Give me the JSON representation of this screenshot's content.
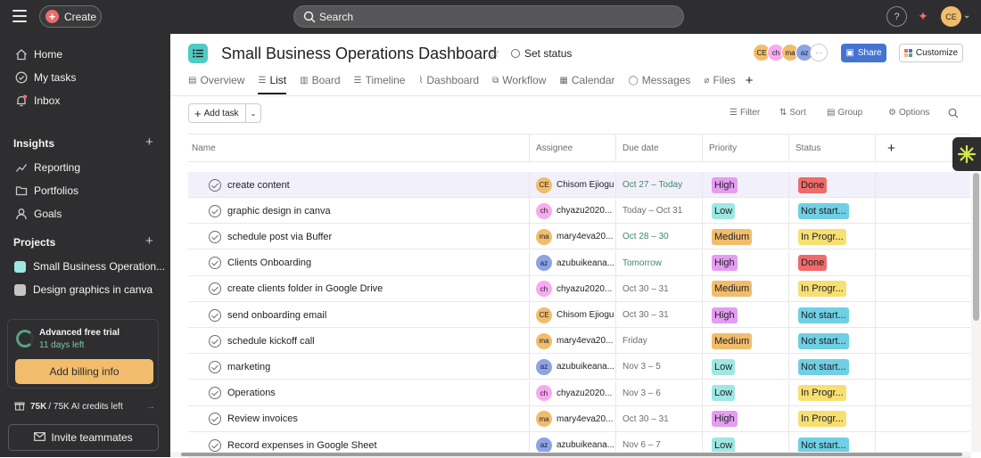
{
  "topbar": {
    "create_label": "Create",
    "search_placeholder": "Search",
    "help_label": "?",
    "user_initials": "CE"
  },
  "sidebar": {
    "nav": [
      {
        "label": "Home",
        "icon": "home-icon"
      },
      {
        "label": "My tasks",
        "icon": "check-circle-icon"
      },
      {
        "label": "Inbox",
        "icon": "bell-icon"
      }
    ],
    "insights_title": "Insights",
    "insights": [
      {
        "label": "Reporting",
        "icon": "chart-icon"
      },
      {
        "label": "Portfolios",
        "icon": "folder-icon"
      },
      {
        "label": "Goals",
        "icon": "person-icon"
      }
    ],
    "projects_title": "Projects",
    "projects": [
      {
        "label": "Small Business Operation...",
        "color": "#9ee7e3"
      },
      {
        "label": "Design graphics in canva",
        "color": "#c7c4c4"
      }
    ],
    "trial": {
      "title": "Advanced free trial",
      "days_left": "11 days left",
      "billing_label": "Add billing info"
    },
    "credits": {
      "strong": "75K",
      "rest": "/ 75K AI credits left"
    },
    "invite_label": "Invite teammates"
  },
  "project": {
    "title": "Small Business Operations Dashboard",
    "set_status": "Set status",
    "members": [
      {
        "initials": "CE",
        "color": "#f1bd6c"
      },
      {
        "initials": "ch",
        "color": "#f9aaef"
      },
      {
        "initials": "ma",
        "color": "#f1bd6c"
      },
      {
        "initials": "az",
        "color": "#8da3e6"
      }
    ],
    "more_members": "···",
    "share_label": "Share",
    "customize_label": "Customize"
  },
  "tabs": [
    {
      "label": "Overview",
      "icon": "overview-icon",
      "glyph": "▤"
    },
    {
      "label": "List",
      "icon": "list-icon",
      "glyph": "☰"
    },
    {
      "label": "Board",
      "icon": "board-icon",
      "glyph": "▥"
    },
    {
      "label": "Timeline",
      "icon": "timeline-icon",
      "glyph": "☰"
    },
    {
      "label": "Dashboard",
      "icon": "dashboard-icon",
      "glyph": "⌇"
    },
    {
      "label": "Workflow",
      "icon": "workflow-icon",
      "glyph": "⧉"
    },
    {
      "label": "Calendar",
      "icon": "calendar-icon",
      "glyph": "▦"
    },
    {
      "label": "Messages",
      "icon": "message-icon",
      "glyph": "◯"
    },
    {
      "label": "Files",
      "icon": "attachment-icon",
      "glyph": "⌀"
    }
  ],
  "toolbar": {
    "add_task_label": "Add task",
    "filter_label": "Filter",
    "sort_label": "Sort",
    "group_label": "Group",
    "options_label": "Options"
  },
  "columns": {
    "name": "Name",
    "assignee": "Assignee",
    "due_date": "Due date",
    "priority": "Priority",
    "status": "Status"
  },
  "colors": {
    "high": "#e49df0",
    "low": "#9ee7e3",
    "medium": "#f1bd6c",
    "done": "#f06a6a",
    "not_started": "#6fd0e5",
    "in_progress": "#f8df72"
  },
  "tasks": [
    {
      "name": "create content",
      "assignee": "Chisom Ejiogu",
      "initials": "CE",
      "avatar_color": "#f1bd6c",
      "due": "Oct 27 – Today",
      "due_green": true,
      "priority": "High",
      "priority_key": "high",
      "status": "Done",
      "status_key": "done"
    },
    {
      "name": "graphic design in canva",
      "assignee": "chyazu2020...",
      "initials": "ch",
      "avatar_color": "#f9aaef",
      "due": "Today – Oct 31",
      "due_green": false,
      "priority": "Low",
      "priority_key": "low",
      "status": "Not start...",
      "status_key": "not_started"
    },
    {
      "name": "schedule post via Buffer",
      "assignee": "mary4eva20...",
      "initials": "ma",
      "avatar_color": "#f1bd6c",
      "due": "Oct 28 – 30",
      "due_green": true,
      "priority": "Medium",
      "priority_key": "medium",
      "status": "In Progr...",
      "status_key": "in_progress"
    },
    {
      "name": "Clients Onboarding",
      "assignee": "azubuikeana...",
      "initials": "az",
      "avatar_color": "#8da3e6",
      "due": "Tomorrow",
      "due_green": true,
      "priority": "High",
      "priority_key": "high",
      "status": "Done",
      "status_key": "done"
    },
    {
      "name": "create clients folder in Google Drive",
      "assignee": "chyazu2020...",
      "initials": "ch",
      "avatar_color": "#f9aaef",
      "due": "Oct 30 – 31",
      "due_green": false,
      "priority": "Medium",
      "priority_key": "medium",
      "status": "In Progr...",
      "status_key": "in_progress"
    },
    {
      "name": "send onboarding email",
      "assignee": "Chisom Ejiogu",
      "initials": "CE",
      "avatar_color": "#f1bd6c",
      "due": "Oct 30 – 31",
      "due_green": false,
      "priority": "High",
      "priority_key": "high",
      "status": "Not start...",
      "status_key": "not_started"
    },
    {
      "name": "schedule kickoff call",
      "assignee": "mary4eva20...",
      "initials": "ma",
      "avatar_color": "#f1bd6c",
      "due": "Friday",
      "due_green": false,
      "priority": "Medium",
      "priority_key": "medium",
      "status": "Not start...",
      "status_key": "not_started"
    },
    {
      "name": "marketing",
      "assignee": "azubuikeana...",
      "initials": "az",
      "avatar_color": "#8da3e6",
      "due": "Nov 3 – 5",
      "due_green": false,
      "priority": "Low",
      "priority_key": "low",
      "status": "Not start...",
      "status_key": "not_started"
    },
    {
      "name": "Operations",
      "assignee": "chyazu2020...",
      "initials": "ch",
      "avatar_color": "#f9aaef",
      "due": "Nov 3 – 6",
      "due_green": false,
      "priority": "Low",
      "priority_key": "low",
      "status": "In Progr...",
      "status_key": "in_progress"
    },
    {
      "name": "Review invoices",
      "assignee": "mary4eva20...",
      "initials": "ma",
      "avatar_color": "#f1bd6c",
      "due": "Oct 30 – 31",
      "due_green": false,
      "priority": "High",
      "priority_key": "high",
      "status": "In Progr...",
      "status_key": "in_progress"
    },
    {
      "name": "Record expenses in Google Sheet",
      "assignee": "azubuikeana...",
      "initials": "az",
      "avatar_color": "#8da3e6",
      "due": "Nov 6 – 7",
      "due_green": false,
      "priority": "Low",
      "priority_key": "low",
      "status": "Not start...",
      "status_key": "not_started"
    }
  ]
}
